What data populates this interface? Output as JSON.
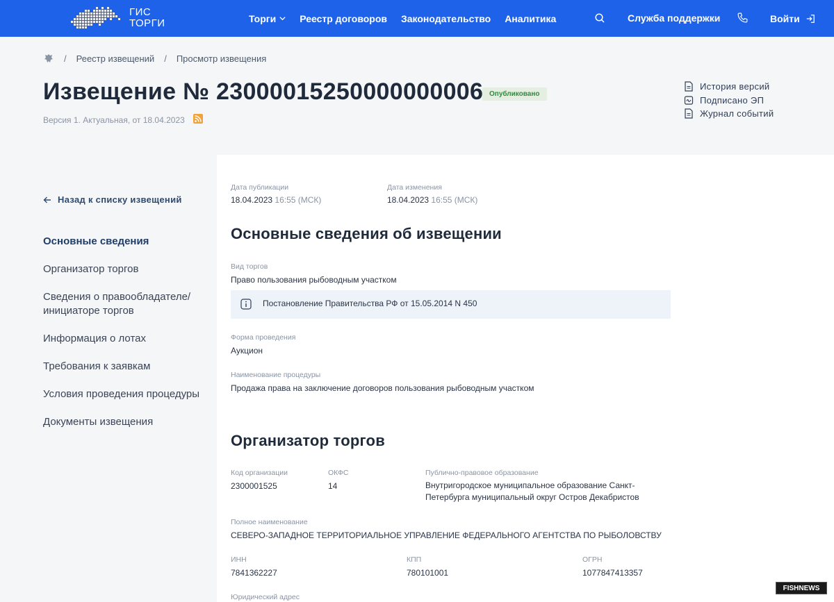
{
  "header": {
    "logo_line1": "ГИС",
    "logo_line2": "ТОРГИ",
    "nav": [
      "Торги",
      "Реестр договоров",
      "Законодательство",
      "Аналитика"
    ],
    "support": "Служба поддержки",
    "login": "Войти",
    "colors": {
      "bar": "#1f62ea"
    }
  },
  "breadcrumbs": [
    "Реестр извещений",
    "Просмотр извещения"
  ],
  "page": {
    "title": "Извещение № 23000015250000000006",
    "status": "Опубликовано",
    "version": "Версия 1. Актуальная, от 18.04.2023"
  },
  "side_links": [
    "История версий",
    "Подписано ЭП",
    "Журнал событий"
  ],
  "left_nav": {
    "back": "Назад к списку извещений",
    "items": [
      "Основные сведения",
      "Организатор торгов",
      "Сведения о правообладателе/ инициаторе торгов",
      "Информация о лотах",
      "Требования к заявкам",
      "Условия проведения процедуры",
      "Документы извещения"
    ]
  },
  "main": {
    "pub_label": "Дата публикации",
    "pub_date": "18.04.2023",
    "pub_time": "16:55 (МСК)",
    "mod_label": "Дата изменения",
    "mod_date": "18.04.2023",
    "mod_time": "16:55 (МСК)",
    "section1_title": "Основные сведения об извещении",
    "type_label": "Вид торгов",
    "type_value": "Право пользования рыбоводным участком",
    "info_note": "Постановление Правительства РФ от 15.05.2014 N 450",
    "form_label": "Форма проведения",
    "form_value": "Аукцион",
    "proc_label": "Наименование процедуры",
    "proc_value": "Продажа права на заключение договоров пользования рыбоводным участком",
    "section2_title": "Организатор торгов",
    "org_code_label": "Код организации",
    "org_code": "2300001525",
    "okfs_label": "ОКФС",
    "okfs": "14",
    "ppo_label": "Публично-правовое образование",
    "ppo_value": "Внутригородское муниципальное образование Санкт-Петербурга муниципальный округ Остров Декабристов",
    "fullname_label": "Полное наименование",
    "fullname": "СЕВЕРО-ЗАПАДНОЕ ТЕРРИТОРИАЛЬНОЕ УПРАВЛЕНИЕ ФЕДЕРАЛЬНОГО АГЕНТСТВА ПО РЫБОЛОВСТВУ",
    "inn_label": "ИНН",
    "inn": "7841362227",
    "kpp_label": "КПП",
    "kpp": "780101001",
    "ogrn_label": "ОГРН",
    "ogrn": "1077847413357",
    "legal_addr_label": "Юридический адрес"
  },
  "watermark": "FISHNEWS"
}
